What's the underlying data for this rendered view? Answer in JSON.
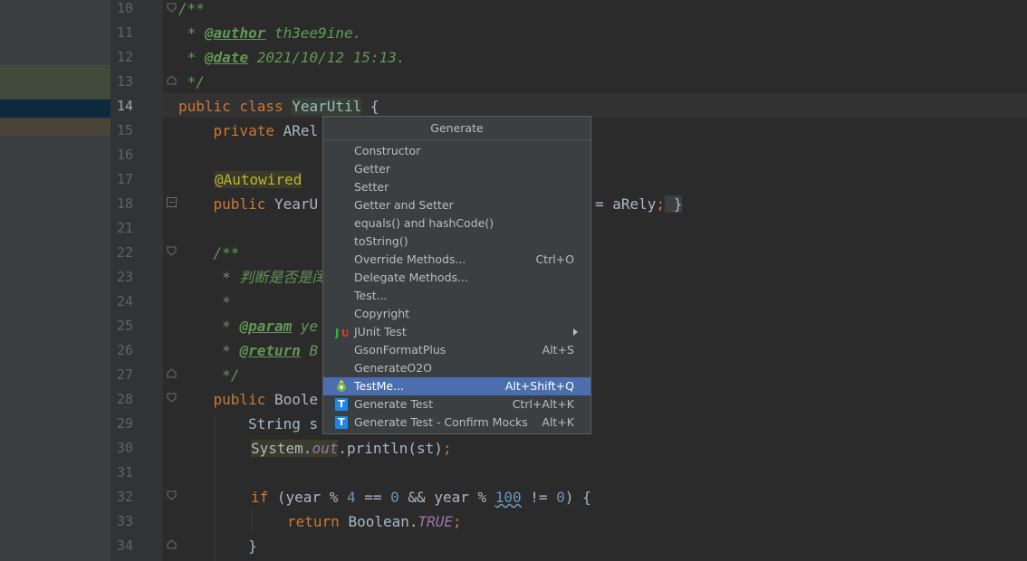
{
  "editor": {
    "line_numbers": [
      "10",
      "11",
      "12",
      "13",
      "14",
      "15",
      "16",
      "17",
      "18",
      "21",
      "22",
      "23",
      "24",
      "25",
      "26",
      "27",
      "28",
      "29",
      "30",
      "31",
      "32",
      "33",
      "34"
    ],
    "lines": {
      "l10": "/**",
      "l11_star": " * ",
      "l11_tag": "@author",
      "l11_text": " th3ee9ine.",
      "l12_star": " * ",
      "l12_tag": "@date",
      "l12_text": " 2021/10/12 15:13.",
      "l13": " */",
      "l14_kw": "public class ",
      "l14_cls": "YearUtil",
      "l14_rest": " {",
      "l15_kw": "    private ",
      "l15_rest": "ARel",
      "l17_ann": "@Autowired",
      "l18_kw": "    public ",
      "l18_rest": "YearU",
      "l18_tail": "= aRely",
      "l18_semi": ";",
      "l18_brace": " }",
      "l22": "    /**",
      "l23": "     * 判断是否是闰",
      "l24": "     *",
      "l25_star": "     * ",
      "l25_tag": "@param",
      "l25_text": " ye",
      "l26_star": "     * ",
      "l26_tag": "@return",
      "l26_text": " B",
      "l27": "     */",
      "l28_kw": "    public ",
      "l28_rest": "Boole",
      "l29": "        String s",
      "l30_a": "System.",
      "l30_b": "out",
      "l30_c": ".println(st)",
      "l30_d": ";",
      "l32_kw": "if ",
      "l32_a": "(year % ",
      "l32_n1": "4",
      "l32_b": " == ",
      "l32_n2": "0",
      "l32_c": " && year % ",
      "l32_n3": "100",
      "l32_d": " != ",
      "l32_n4": "0",
      "l32_e": ") {",
      "l33_kw": "return ",
      "l33_a": "Boolean.",
      "l33_b": "TRUE",
      "l33_c": ";",
      "l34": "        }"
    }
  },
  "popup": {
    "title": "Generate",
    "items": [
      {
        "label": "Constructor",
        "shortcut": "",
        "icon": ""
      },
      {
        "label": "Getter",
        "shortcut": "",
        "icon": ""
      },
      {
        "label": "Setter",
        "shortcut": "",
        "icon": ""
      },
      {
        "label": "Getter and Setter",
        "shortcut": "",
        "icon": ""
      },
      {
        "label": "equals() and hashCode()",
        "shortcut": "",
        "icon": ""
      },
      {
        "label": "toString()",
        "shortcut": "",
        "icon": ""
      },
      {
        "label": "Override Methods...",
        "shortcut": "Ctrl+O",
        "icon": ""
      },
      {
        "label": "Delegate Methods...",
        "shortcut": "",
        "icon": ""
      },
      {
        "label": "Test...",
        "shortcut": "",
        "icon": ""
      },
      {
        "label": "Copyright",
        "shortcut": "",
        "icon": ""
      },
      {
        "label": "JUnit Test",
        "shortcut": "",
        "icon": "junit-icon"
      },
      {
        "label": "GsonFormatPlus",
        "shortcut": "Alt+S",
        "icon": ""
      },
      {
        "label": "GenerateO2O",
        "shortcut": "",
        "icon": ""
      },
      {
        "label": "TestMe...",
        "shortcut": "Alt+Shift+Q",
        "icon": "testme-icon"
      },
      {
        "label": "Generate Test",
        "shortcut": "Ctrl+Alt+K",
        "icon": "t-icon"
      },
      {
        "label": "Generate Test - Confirm Mocks",
        "shortcut": "Alt+K",
        "icon": "t-icon"
      }
    ]
  },
  "colors": {
    "selection": "#4b6eaf",
    "keyword": "#cc7832",
    "comment": "#629755",
    "annotation": "#bbb529"
  }
}
